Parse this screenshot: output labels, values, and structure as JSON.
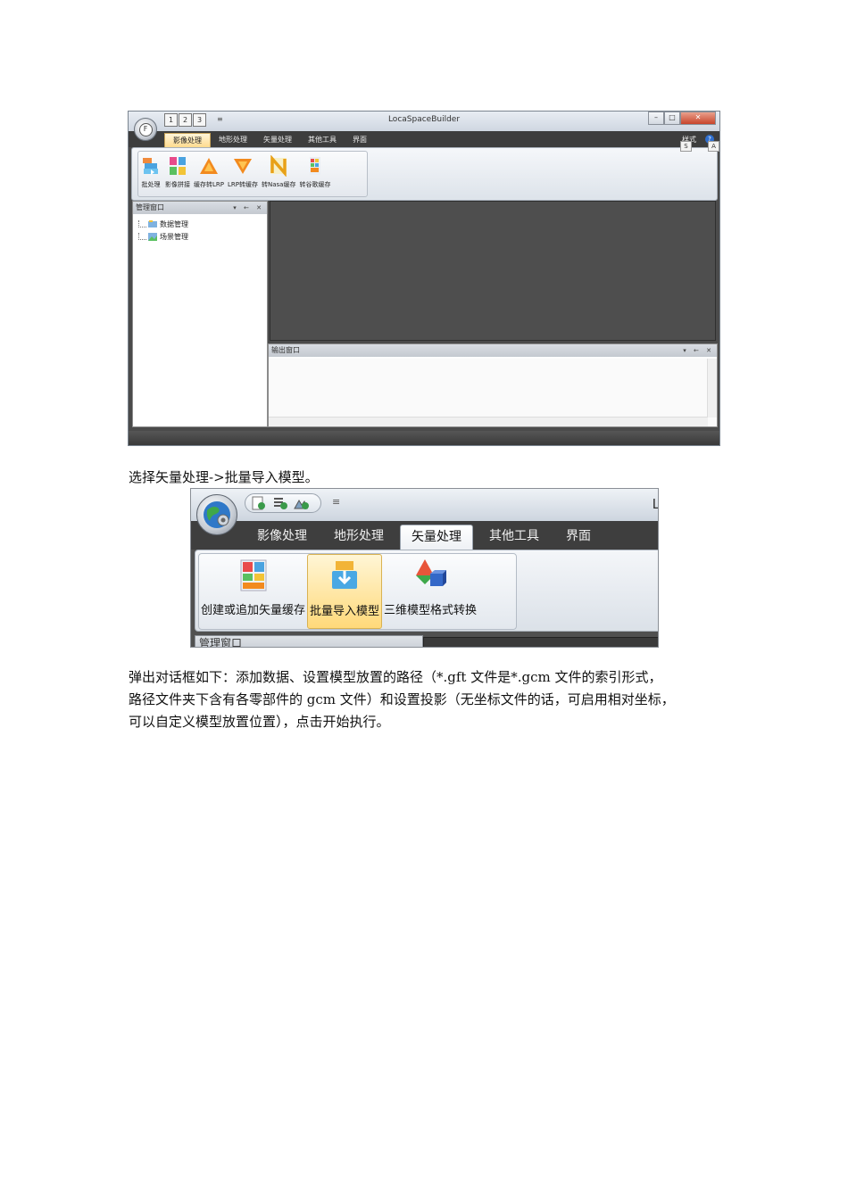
{
  "shot1": {
    "window_title": "LocaSpaceBuilder",
    "app_button": "F",
    "qat_keys": [
      "1",
      "2",
      "3"
    ],
    "qat_more": "≡",
    "window_controls": [
      "–",
      "□",
      "✕"
    ],
    "tabs": [
      "影像处理",
      "地形处理",
      "矢量处理",
      "其他工具",
      "界面"
    ],
    "active_tab": 0,
    "style_label": "样式",
    "help_glyph": "?",
    "keytips": [
      "S",
      "A"
    ],
    "ribbon_buttons": [
      {
        "label": "批处理",
        "icon": "batch-icon"
      },
      {
        "label": "影像拼接",
        "icon": "mosaic-icon"
      },
      {
        "label": "缓存转LRP",
        "icon": "cache-to-lrp-icon"
      },
      {
        "label": "LRP转缓存",
        "icon": "lrp-to-cache-icon"
      },
      {
        "label": "转Nasa缓存",
        "icon": "nasa-cache-icon"
      },
      {
        "label": "转谷歌缓存",
        "icon": "google-cache-icon"
      }
    ],
    "left_panel": {
      "title": "管理窗口",
      "controls": "▾ ← ✕",
      "items": [
        {
          "label": "数据管理",
          "icon": "data-manage-icon"
        },
        {
          "label": "场景管理",
          "icon": "scene-manage-icon"
        }
      ]
    },
    "output_panel": {
      "title": "输出窗口",
      "controls": "▾ ← ✕"
    },
    "colors": {
      "active_tab": "#ffd98a",
      "workspace": "#4e4e4e"
    }
  },
  "caption1": "选择矢量处理->批量导入模型。",
  "shot2": {
    "title_fragment": "L",
    "qat_more": "≡",
    "tabs": [
      "影像处理",
      "地形处理",
      "矢量处理",
      "其他工具",
      "界面"
    ],
    "active_tab": 2,
    "ribbon_buttons": [
      {
        "label": "创建或追加矢量缓存",
        "icon": "vector-cache-icon"
      },
      {
        "label": "批量导入模型",
        "icon": "batch-import-3d-icon",
        "hover": true
      },
      {
        "label": "三维模型格式转换",
        "icon": "model-convert-icon"
      }
    ],
    "panel_title_fragment": "管理窗口",
    "colors": {
      "hover_button": "#ffd97a"
    }
  },
  "paragraph": [
    "弹出对话框如下：添加数据、设置模型放置的路径（*.gft 文件是*.gcm 文件的索引形式，",
    "路径文件夹下含有各零部件的 gcm 文件）和设置投影（无坐标文件的话，可启用相对坐标，",
    "可以自定义模型放置位置），点击开始执行。"
  ]
}
